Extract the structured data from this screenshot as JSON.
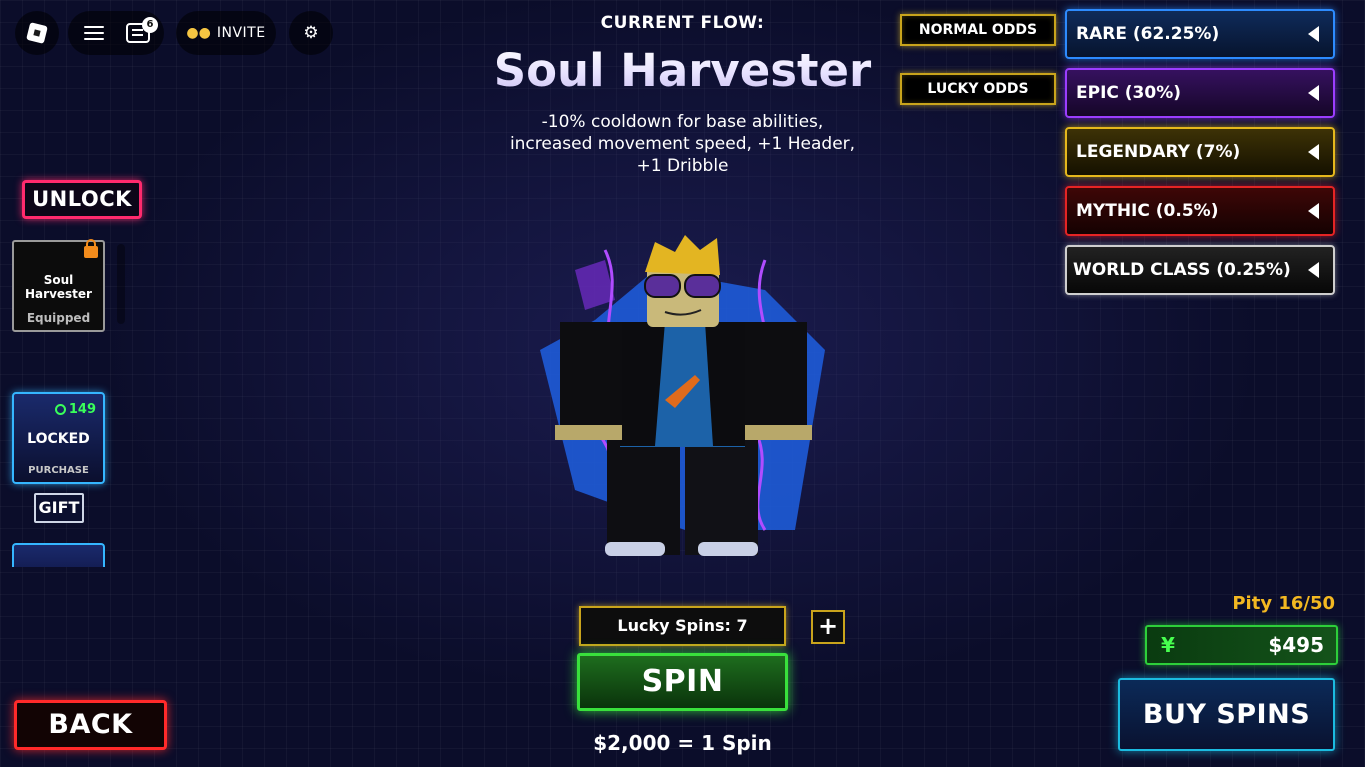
{
  "topbar": {
    "chat_badge": "6",
    "invite_label": "INVITE"
  },
  "header": {
    "subtitle": "CURRENT FLOW:",
    "flow_name": "Soul Harvester",
    "description": "-10% cooldown for base abilities, increased movement speed, +1 Header, +1 Dribble"
  },
  "odds": {
    "normal_label": "NORMAL ODDS",
    "lucky_label": "LUCKY ODDS",
    "rarities": [
      {
        "label": "RARE (62.25%)",
        "color": "#2d8bff"
      },
      {
        "label": "EPIC (30%)",
        "color": "#9b3dff"
      },
      {
        "label": "LEGENDARY (7%)",
        "color": "#e5b81c"
      },
      {
        "label": "MYTHIC (0.5%)",
        "color": "#e52424"
      },
      {
        "label": "WORLD CLASS (0.25%)",
        "color": "#cfcfcf"
      }
    ]
  },
  "left_panel": {
    "unlock_label": "UNLOCK",
    "flow_card": {
      "name": "Soul Harvester",
      "status": "Equipped"
    },
    "locked_card": {
      "price": "149",
      "title": "LOCKED",
      "subtitle": "PURCHASE"
    },
    "gift_label": "GIFT"
  },
  "back_label": "BACK",
  "spin_area": {
    "lucky_spins": "Lucky Spins: 7",
    "plus": "+",
    "spin_label": "SPIN",
    "price_text": "$2,000 = 1 Spin"
  },
  "economy": {
    "pity": "Pity 16/50",
    "currency_symbol": "¥",
    "money": "$495",
    "buy_label": "BUY SPINS"
  }
}
